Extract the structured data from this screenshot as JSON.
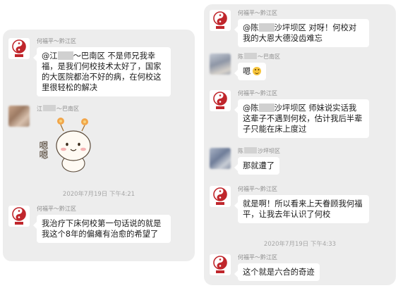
{
  "colors": {
    "panel_background": "#ededed",
    "bubble_background": "#ffffff",
    "sender_text": "#8c8c8c",
    "timestamp_text": "#a6a6a6",
    "logo_red": "#c0262c"
  },
  "left_chat": {
    "messages": [
      {
        "sender": "何福平～黔江区",
        "avatar_icon": "taiji-logo-icon",
        "text_prefix": "@江",
        "text_body": "～巴南区 不是师兄我幸福，是我们何校技术太好了，国家的大医院都治不好的病，在何校这里很轻松的解决"
      },
      {
        "sender_prefix": "江",
        "sender_suffix": "～巴南区",
        "avatar_icon": "blurred-avatar",
        "sticker_icon": "round-cartoon-sticker",
        "sticker_text": "嗯嗯"
      }
    ],
    "timestamp": "2020年7月19日 下午4:21",
    "messages_after": [
      {
        "sender": "何福平～黔江区",
        "avatar_icon": "taiji-logo-icon",
        "text": "我治疗下床何校第一句话说的就是我这个8年的偏瘫有治愈的希望了"
      }
    ]
  },
  "right_chat": {
    "messages": [
      {
        "sender": "何福平～黔江区",
        "avatar_icon": "taiji-logo-icon",
        "text_prefix": "@陈",
        "text_body": "沙坪坝区 对呀！何校对我的大恩大德没齿难忘"
      },
      {
        "sender_prefix": "陈",
        "sender_suffix": "～巴南区",
        "avatar_icon": "blurred-avatar",
        "text": "嗯",
        "emoji_icon": "smile-emoji-icon"
      },
      {
        "sender": "何福平～黔江区",
        "avatar_icon": "taiji-logo-icon",
        "text_prefix": "@陈",
        "text_body": "沙坪坝区 师妹说实话我这辈子不遇到何校，估计我后半辈子只能在床上度过"
      },
      {
        "sender_prefix": "陈",
        "sender_suffix": "沙坪坝区",
        "avatar_icon": "blurred-avatar",
        "text": "那就遭了"
      },
      {
        "sender": "何福平～黔江区",
        "avatar_icon": "taiji-logo-icon",
        "text": "就是啊！所以看来上天眷顾我何福平，让我去年认识了何校"
      }
    ],
    "timestamp": "2020年7月19日 下午4:33",
    "messages_after": [
      {
        "sender": "何福平～黔江区",
        "avatar_icon": "taiji-logo-icon",
        "text": "这个就是六合的奇迹"
      }
    ]
  }
}
